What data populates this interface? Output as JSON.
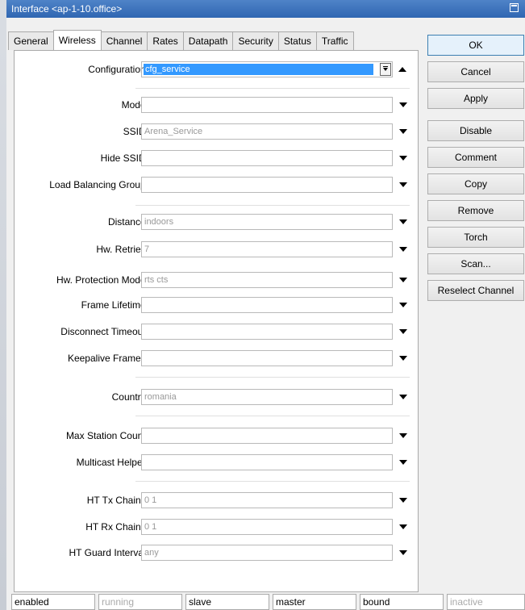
{
  "window": {
    "title": "Interface <ap-1-10.office>"
  },
  "tabs": [
    "General",
    "Wireless",
    "Channel",
    "Rates",
    "Datapath",
    "Security",
    "Status",
    "Traffic"
  ],
  "active_tab": "Wireless",
  "configuration": {
    "label": "Configuration:",
    "value": "cfg_service"
  },
  "fields": [
    {
      "label": "Mode:",
      "value": ""
    },
    {
      "label": "SSID:",
      "value": "Arena_Service"
    },
    {
      "label": "Hide SSID:",
      "value": ""
    },
    {
      "label": "Load Balancing Group:",
      "value": ""
    },
    {
      "label": "Distance:",
      "value": "indoors"
    },
    {
      "label": "Hw. Retries:",
      "value": "7"
    },
    {
      "label": "Hw. Protection Mode:",
      "value": "rts cts"
    },
    {
      "label": "Frame Lifetime:",
      "value": ""
    },
    {
      "label": "Disconnect Timeout:",
      "value": ""
    },
    {
      "label": "Keepalive Frames:",
      "value": ""
    },
    {
      "label": "Country:",
      "value": "romania"
    },
    {
      "label": "Max Station Count:",
      "value": ""
    },
    {
      "label": "Multicast Helper:",
      "value": ""
    },
    {
      "label": "HT Tx Chains:",
      "value": "0 1"
    },
    {
      "label": "HT Rx Chains:",
      "value": "0 1"
    },
    {
      "label": "HT Guard Interval:",
      "value": "any"
    }
  ],
  "buttons": [
    "OK",
    "Cancel",
    "Apply",
    "Disable",
    "Comment",
    "Copy",
    "Remove",
    "Torch",
    "Scan...",
    "Reselect Channel"
  ],
  "statusbar": [
    "enabled",
    "running",
    "slave",
    "master",
    "bound",
    "inactive"
  ]
}
